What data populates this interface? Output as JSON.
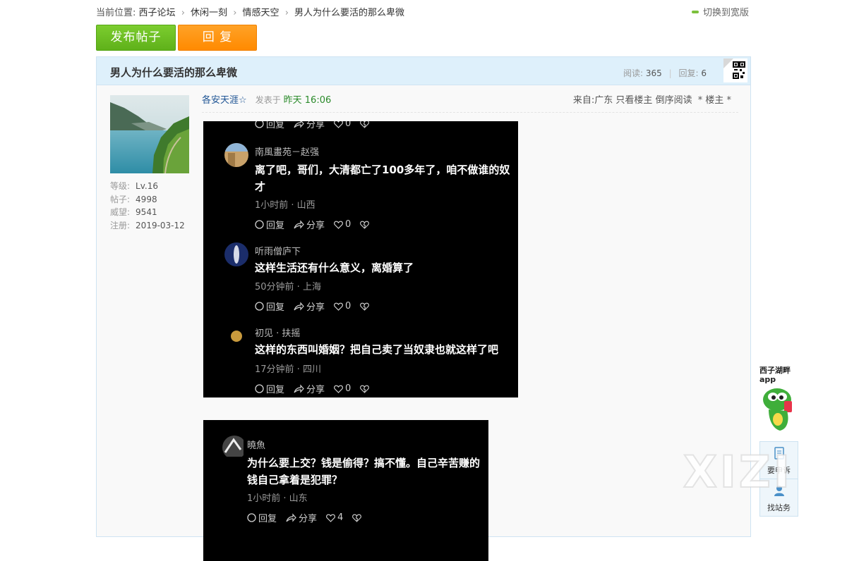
{
  "breadcrumb": {
    "prefix": "当前位置:",
    "items": [
      "西子论坛",
      "休闲一刻",
      "情感天空",
      "男人为什么要活的那么卑微"
    ]
  },
  "widen_label": "切换到宽版",
  "actions": {
    "post": "发布帖子",
    "reply": "回 复"
  },
  "thread": {
    "title": "男人为什么要活的那么卑微",
    "read_label": "阅读:",
    "read_count": "365",
    "reply_label": "回复:",
    "reply_count": "6"
  },
  "author": {
    "level_label": "等级:",
    "level": "Lv.16",
    "posts_label": "帖子:",
    "posts": "4998",
    "prestige_label": "威望:",
    "prestige": "9541",
    "reg_label": "注册:",
    "reg": "2019-03-12"
  },
  "post": {
    "poster": "各安天涯☆",
    "posted_label": "发表于",
    "posted_time": "昨天 16:06",
    "from": "来自:广东",
    "only_owner": "只看楼主",
    "reverse": "倒序阅读",
    "floor": "* 楼主 *"
  },
  "shot1": {
    "top_acts": {
      "reply": "回复",
      "share": "分享",
      "likes": "0"
    },
    "comments": [
      {
        "name": "南風畫苑－赵强",
        "text": "离了吧，哥们，大清都亡了100多年了，咱不做谁的奴才",
        "meta": "1小时前 · 山西",
        "reply": "回复",
        "share": "分享",
        "likes": "0"
      },
      {
        "name": "听雨僧庐下",
        "text": "这样生活还有什么意义，离婚算了",
        "meta": "50分钟前 · 上海",
        "reply": "回复",
        "share": "分享",
        "likes": "0"
      },
      {
        "name": "初见 · 扶摇",
        "text": "这样的东西叫婚姻？把自己卖了当奴隶也就这样了吧",
        "meta": "17分钟前 · 四川",
        "reply": "回复",
        "share": "分享",
        "likes": "0"
      }
    ]
  },
  "shot2": {
    "comment": {
      "name": "曉魚",
      "text": "为什么要上交？钱是偷得？搞不懂。自己辛苦赚的钱自己拿着是犯罪？",
      "meta": "1小时前 · 山东",
      "reply": "回复",
      "share": "分享",
      "likes": "4"
    }
  },
  "side": {
    "app_label": "西子湖畔 app",
    "complaint": "要申诉",
    "find_staff": "找站务"
  },
  "watermark": "XIZI",
  "colors": {
    "post_button": "#6cc024",
    "reply_button": "#ff9419",
    "header_bg": "#def0fb",
    "link": "#1e5494"
  }
}
